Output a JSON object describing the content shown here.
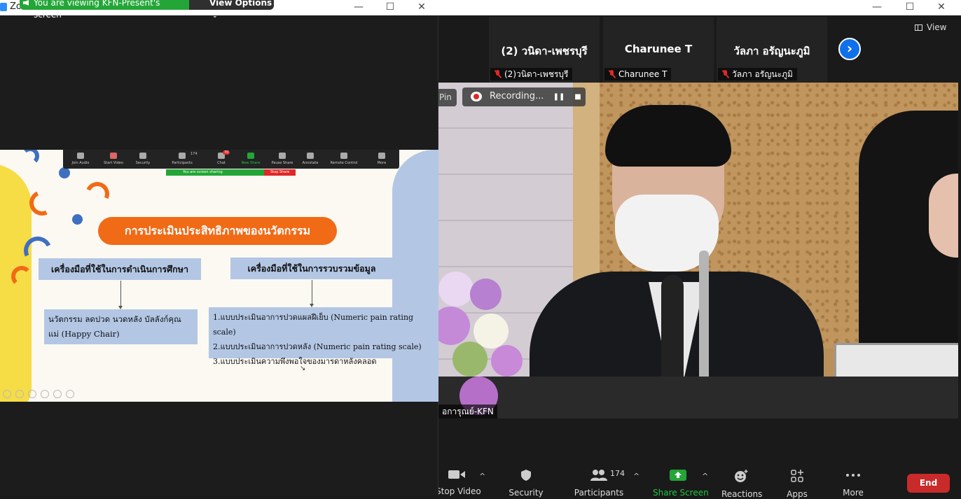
{
  "share_window": {
    "app_title": "Zo",
    "banner": "You are viewing KFN-Present's screen",
    "view_options": "View Options",
    "slide": {
      "title": "การประเมินประสิทธิภาพของนวัตกรรม",
      "left_box_title": "เครื่องมือที่ใช้ในการดำเนินการศึกษา",
      "left_box_body": [
        "นวัตกรรม ลดปวด นวดหลัง บัลลังก์คุณ",
        "แม่ (Happy Chair)"
      ],
      "right_box_title": "เครื่องมือที่ใช้ในการรวบรวมข้อมูล",
      "right_box_items": [
        "1.แบบประเมินอาการปวดแผลฝีเย็บ (Numeric pain rating scale)",
        "2.แบบประเมินอาการปวดหลัง (Numeric pain rating scale)",
        "3.แบบประเมินความพึงพอใจของมารดาหลังคลอด"
      ],
      "mini_toolbar": {
        "items": [
          "Join Audio",
          "Start Video",
          "Security",
          "Participants",
          "Chat",
          "New Share",
          "Pause Share",
          "Annotate",
          "Remote Control",
          "More"
        ],
        "participants_count": "174",
        "chat_badge": "70",
        "sharing_text": "You are screen sharing",
        "stop_share": "Stop Share"
      }
    }
  },
  "main_window": {
    "view_label": "View",
    "thumbnails": [
      {
        "name": "(2) วนิดา-เพชรบุรี",
        "footer": "(2)วนิดา-เพชรบุรี"
      },
      {
        "name": "Charunee T",
        "footer": "Charunee T"
      },
      {
        "name": "วัลภา อรัญนะภูมิ",
        "footer": "วัลภา อรัญนะภูมิ"
      }
    ],
    "pin_label": "Pin",
    "recording_label": "Recording...",
    "video_name": "อการุณย์-KFN",
    "toolbar": {
      "stop_video": "Stop Video",
      "security": "Security",
      "participants": "Participants",
      "participants_count": "174",
      "share_screen": "Share Screen",
      "reactions": "Reactions",
      "apps": "Apps",
      "more": "More",
      "end": "End"
    },
    "colors": {
      "share_green": "#23a637",
      "end_red": "#c92a2a",
      "accent_blue": "#0e71eb"
    }
  }
}
